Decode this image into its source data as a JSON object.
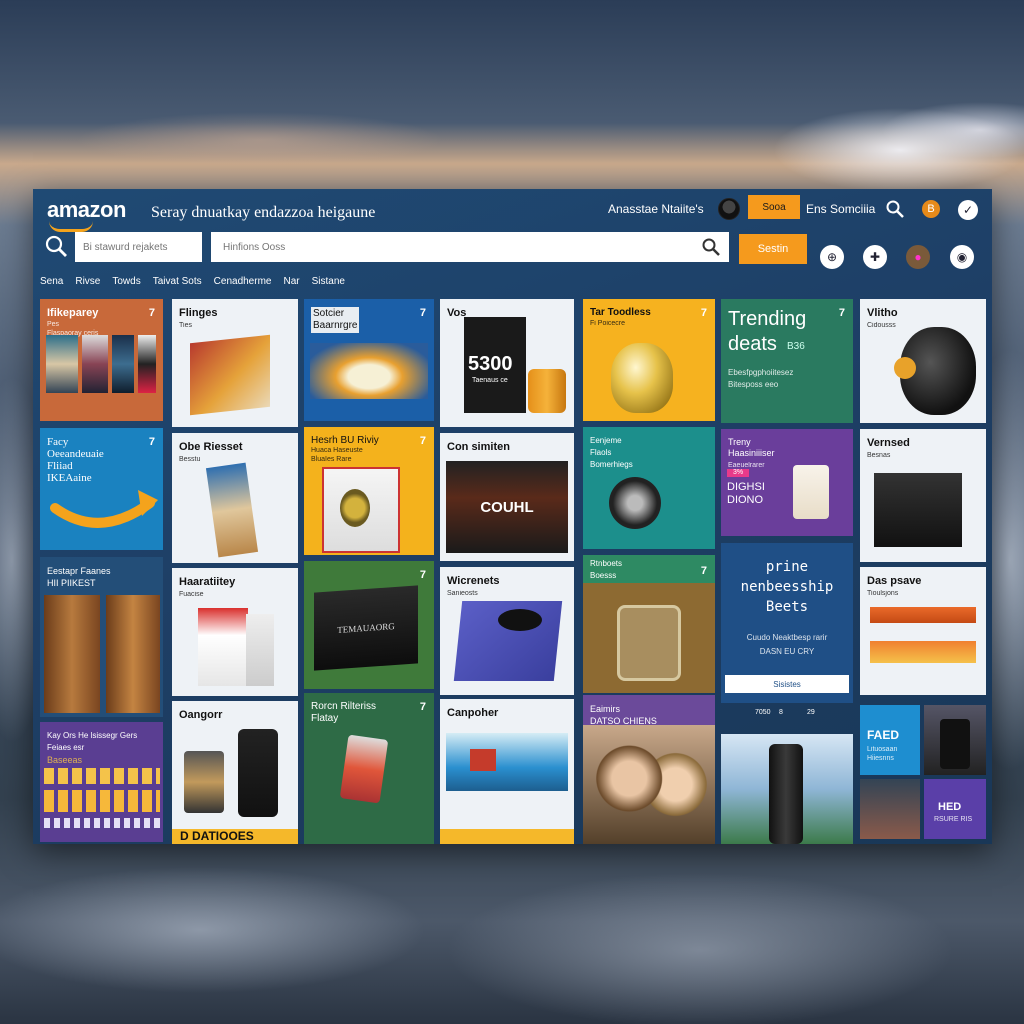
{
  "header": {
    "logo": "amazon",
    "tagline": "Seray dnuatkay endazzoa heigaune",
    "account_label": "Anasstae Ntaiite's",
    "orange_pill": "Sooa",
    "signin": "Ens Somciiia",
    "icon_1": "B",
    "icon_2": "✓"
  },
  "search": {
    "small_placeholder": "Bi stawurd rejakets",
    "main_placeholder": "Hinfions Ooss",
    "button": "Sestin"
  },
  "toolbar_icons": [
    "⊕",
    "✚",
    "●",
    "◉"
  ],
  "nav": [
    "Sena",
    "Rivse",
    "Towds",
    "Taivat Sots",
    "Cenadherme",
    "Nar",
    "Sistane"
  ],
  "tiles": {
    "c1t1": {
      "title": "Ifikeparey",
      "sub": "Pes\nFlaspaoray ceris",
      "badge": "7"
    },
    "c1t2": {
      "title": "Facy\nOeeandeuaie\nFliiad\nIKEAaine",
      "badge": "7"
    },
    "c1t3": {
      "title": "Eestapr Faanes\nHII PIIKEST"
    },
    "c1t4": {
      "title": "Kay Ors He lsissegr Gers\nFeiaes esr",
      "sub": "Baseeas"
    },
    "c2t1": {
      "title": "Flinges",
      "sub": "Ties"
    },
    "c2t2": {
      "title": "Obe Riesset",
      "sub": "Besstu"
    },
    "c2t3": {
      "title": "Haaratiitey",
      "sub": "Fuacise"
    },
    "c2t4": {
      "title": "Oangorr",
      "banner": "D DATIOOES"
    },
    "c3t1": {
      "title": "Sotcier\nBaarnrgre",
      "badge": "7"
    },
    "c3t2": {
      "title": "Hesrh BU Riviy",
      "sub": "Huaca Haseuste\nBluaIes Rare",
      "badge": "7"
    },
    "c3t3": {
      "badge": "7",
      "label": "TEMAUAORG"
    },
    "c3t4": {
      "title": "Rorcn Rilteriss\nFlatay",
      "badge": "7"
    },
    "c4t1": {
      "title": "Vos",
      "price": "5300",
      "sub": "Taenaus ce"
    },
    "c4t2": {
      "title": "Con simiten",
      "label": "COUHL"
    },
    "c4t3": {
      "title": "Wicrenets",
      "sub": "Sanieosts"
    },
    "c4t4": {
      "title": "Canpoher"
    },
    "c5t1": {
      "title": "Tar Toodless",
      "sub": "Fi Poicecre",
      "badge": "7"
    },
    "c5t2": {
      "title": "Eenjeme\nFlaols\nBomerhiegs"
    },
    "c5t3": {
      "title": "Rtnboets\nBoesss",
      "badge": "7"
    },
    "c5t4": {
      "title": "Eaimirs\nDATSO CHIENS"
    },
    "c6t1": {
      "title": "Trending\ndeats",
      "sub": "Ebesfpgphoiitesez\nBitesposs eeo",
      "badge": "7",
      "tag": "B36"
    },
    "c6t2": {
      "title": "Treny\nHaasiniiiser",
      "sub": "Eaeuelrarer",
      "promo": "DIGHSI\nDIONO",
      "tag": "3%"
    },
    "c6t3": {
      "title": "prine\nnenbeesship\nBeets",
      "sub": "Cuudo Neaktbesp rarir\nDASN EU CRY",
      "button": "Sisistes",
      "footer": [
        "7050",
        "8",
        "29"
      ]
    },
    "c7t1": {
      "title": "Vlitho",
      "sub": "Cidousss"
    },
    "c7t2": {
      "title": "Vernsed",
      "sub": "Besnas"
    },
    "c7t3": {
      "title": "Das psave",
      "sub": "Tioulsjons"
    },
    "c7t4a": {
      "title": "FAED",
      "sub": "Lituosaan\nHiiesnns"
    },
    "c7t4d": {
      "title": "HED",
      "sub": "RSURE RIS"
    }
  }
}
